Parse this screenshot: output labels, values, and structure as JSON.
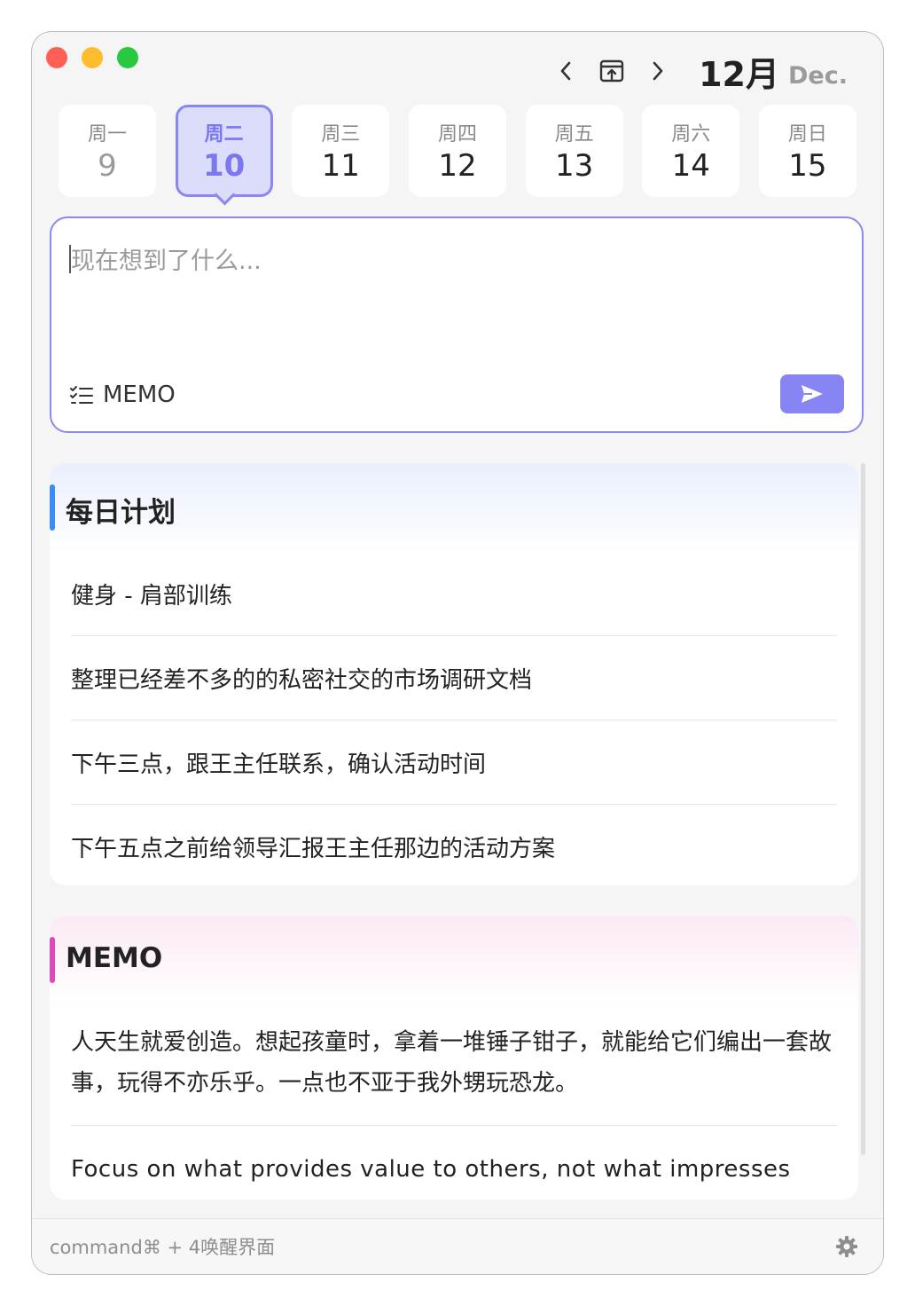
{
  "window": {
    "controls": [
      "close",
      "minimize",
      "zoom"
    ]
  },
  "nav": {
    "prev_icon": "chevron-left-icon",
    "today_icon": "calendar-today-icon",
    "next_icon": "chevron-right-icon",
    "month": "12月",
    "month_en": "Dec."
  },
  "week": [
    {
      "name": "周一",
      "num": "9",
      "state": "past"
    },
    {
      "name": "周二",
      "num": "10",
      "state": "active"
    },
    {
      "name": "周三",
      "num": "11",
      "state": "future"
    },
    {
      "name": "周四",
      "num": "12",
      "state": "future"
    },
    {
      "name": "周五",
      "num": "13",
      "state": "future"
    },
    {
      "name": "周六",
      "num": "14",
      "state": "future"
    },
    {
      "name": "周日",
      "num": "15",
      "state": "future"
    }
  ],
  "editor": {
    "placeholder": "现在想到了什么...",
    "tag_label": "MEMO",
    "tag_icon": "checklist-icon",
    "send_icon": "send-icon"
  },
  "plan": {
    "title": "每日计划",
    "items": [
      "健身 - 肩部训练",
      "整理已经差不多的的私密社交的市场调研文档",
      "下午三点，跟王主任联系，确认活动时间",
      "下午五点之前给领导汇报王主任那边的活动方案"
    ]
  },
  "memo": {
    "title": "MEMO",
    "items": [
      "人天生就爱创造。想起孩童时，拿着一堆锤子钳子，就能给它们编出一套故事，玩得不亦乐乎。一点也不亚于我外甥玩恐龙。",
      "Focus on what provides value to others, not what impresses others."
    ]
  },
  "footer": {
    "hint": "command⌘ + 4唤醒界面",
    "settings_icon": "gear-icon"
  },
  "colors": {
    "accent": "#8784f3",
    "plan_bar": "#3b8cf5",
    "memo_bar": "#d94bb8"
  }
}
